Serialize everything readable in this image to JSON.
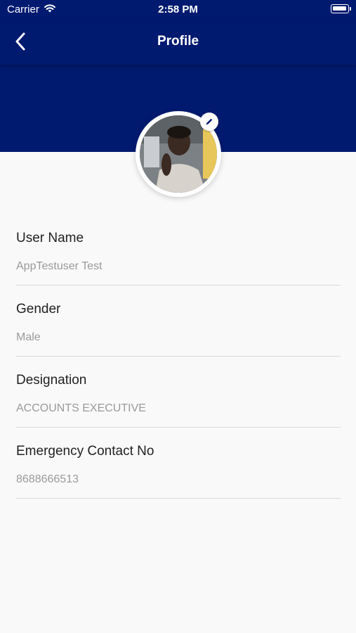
{
  "status_bar": {
    "carrier": "Carrier",
    "time": "2:58 PM"
  },
  "nav": {
    "title": "Profile",
    "back_icon": "chevron-left-icon"
  },
  "profile": {
    "avatar_icon": "user-photo",
    "edit_icon": "pencil-icon"
  },
  "fields": [
    {
      "label": "User Name",
      "value": "AppTestuser Test"
    },
    {
      "label": "Gender",
      "value": "Male"
    },
    {
      "label": "Designation",
      "value": "ACCOUNTS EXECUTIVE"
    },
    {
      "label": "Emergency Contact No",
      "value": "8688666513"
    }
  ],
  "colors": {
    "header": "#001a70",
    "background": "#f9f9f9",
    "label": "#222222",
    "value": "#9a9a9a",
    "divider": "#d9d9d9"
  }
}
